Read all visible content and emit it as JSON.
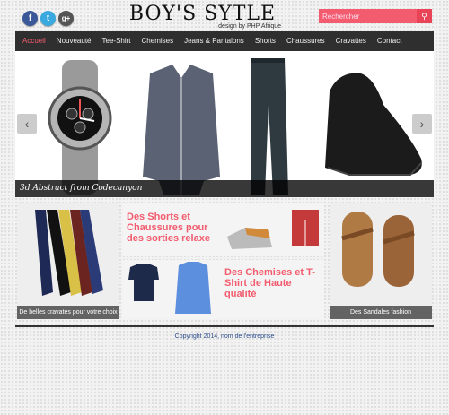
{
  "social": {
    "facebook": "f",
    "twitter": "t",
    "google": "g+"
  },
  "logo": {
    "title": "BOY'S SYTLE",
    "subtitle": "design by PHP Afrique"
  },
  "search": {
    "placeholder": "Rechercher"
  },
  "nav": {
    "items": [
      "Accueil",
      "Nouveauté",
      "Tee-Shirt",
      "Chemises",
      "Jeans & Pantalons",
      "Shorts",
      "Chaussures",
      "Cravattes",
      "Contact"
    ],
    "active": 0
  },
  "slider": {
    "caption": "3d Abstract from Codecanyon",
    "prev": "‹",
    "next": "›"
  },
  "panels": {
    "ties_label": "De belles cravates pour votre choix",
    "shorts_title": "Des Shorts et Chaussures pour des sorties relaxe",
    "chemises_title": "Des Chemises et T-Shirt de Haute qualité",
    "sandals_label": "Des Sandales fashion"
  },
  "footer": {
    "text": "Copyright 2014, nom de l'entreprise"
  },
  "colors": {
    "accent": "#f25c6e",
    "nav_bg": "#2f2f2f",
    "footer_text": "#2b4a8a"
  }
}
